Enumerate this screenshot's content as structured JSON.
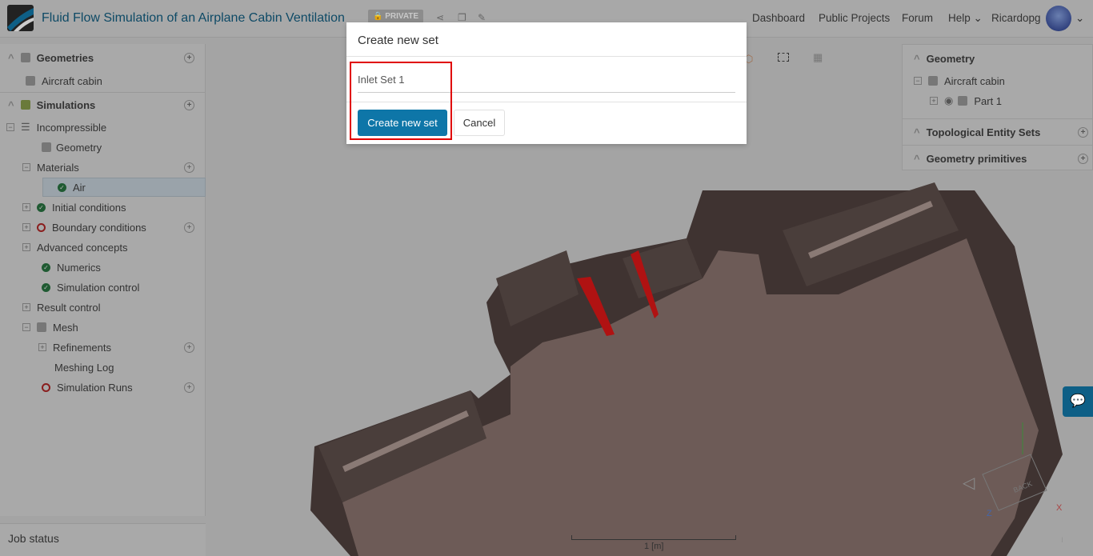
{
  "header": {
    "title": "Fluid Flow Simulation of an Airplane Cabin Ventilation",
    "badge": "PRIVATE",
    "nav": [
      "Dashboard",
      "Public Projects",
      "Forum",
      "Help"
    ],
    "user": "Ricardopg"
  },
  "left_tree": {
    "geometries": "Geometries",
    "geometry_item": "Aircraft cabin",
    "simulations": "Simulations",
    "items": [
      "Incompressible",
      "Geometry",
      "Materials",
      "Air",
      "Initial conditions",
      "Boundary conditions",
      "Advanced concepts",
      "Numerics",
      "Simulation control",
      "Result control",
      "Mesh",
      "Refinements",
      "Meshing Log",
      "Simulation Runs"
    ]
  },
  "job_status": "Job status",
  "right_panel": {
    "geometry": "Geometry",
    "cabin": "Aircraft cabin",
    "part": "Part 1",
    "sets": "Topological Entity Sets",
    "primitives": "Geometry primitives"
  },
  "modal": {
    "title": "Create new set",
    "input_value": "Inlet Set 1",
    "create": "Create new set",
    "cancel": "Cancel"
  },
  "viewport": {
    "scale_label": "1 [m]",
    "cube_face": "BACK",
    "axis_z": "Z",
    "axis_x": "X"
  }
}
